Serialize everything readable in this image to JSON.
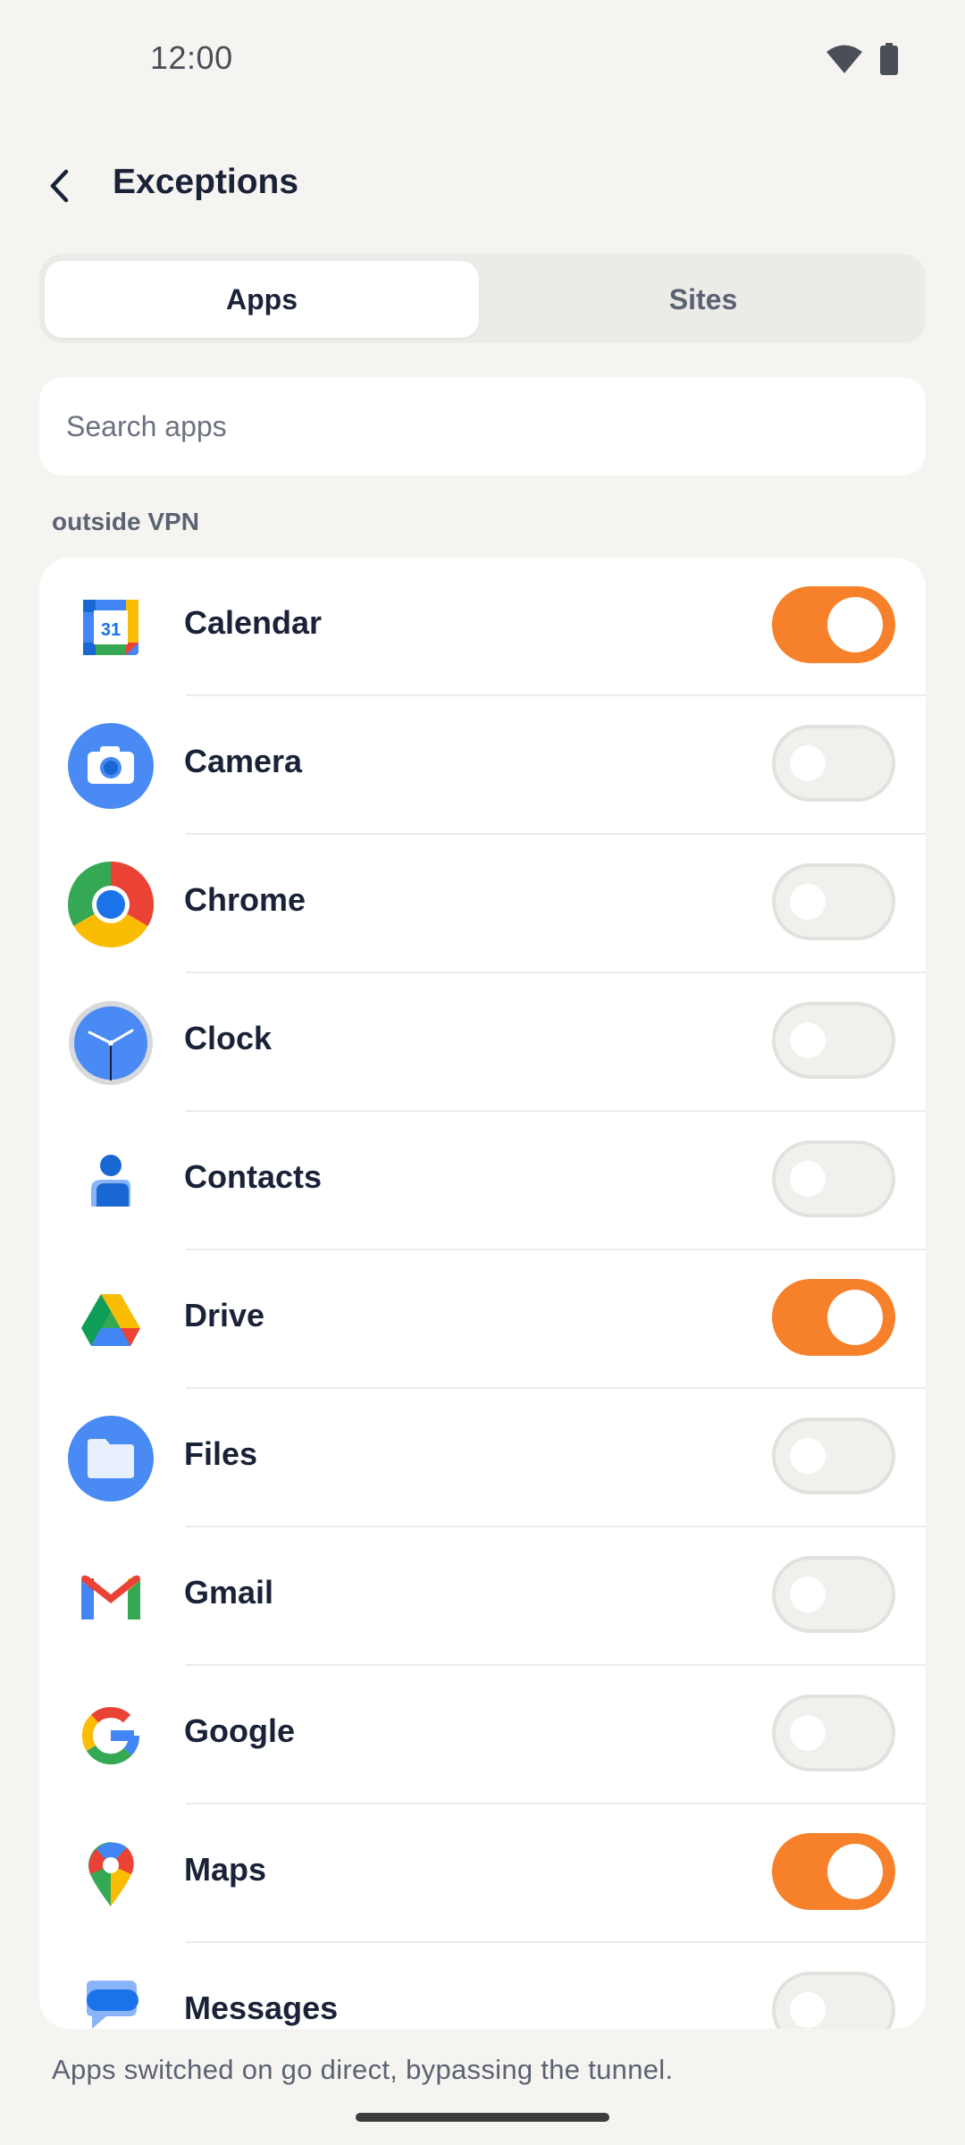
{
  "status_bar": {
    "time": "12:00",
    "icons": [
      "wifi-icon",
      "battery-icon"
    ]
  },
  "header": {
    "back_icon": "back-arrow-icon",
    "title": "Exceptions"
  },
  "tabs": [
    {
      "label": "Apps",
      "active": true
    },
    {
      "label": "Sites",
      "active": false
    }
  ],
  "search": {
    "placeholder": "Search apps",
    "value": ""
  },
  "section": {
    "label": "outside VPN"
  },
  "apps": [
    {
      "name": "Calendar",
      "icon": "calendar-icon",
      "enabled": true
    },
    {
      "name": "Camera",
      "icon": "camera-icon",
      "enabled": false
    },
    {
      "name": "Chrome",
      "icon": "chrome-icon",
      "enabled": false
    },
    {
      "name": "Clock",
      "icon": "clock-icon",
      "enabled": false
    },
    {
      "name": "Contacts",
      "icon": "contacts-icon",
      "enabled": false
    },
    {
      "name": "Drive",
      "icon": "drive-icon",
      "enabled": true
    },
    {
      "name": "Files",
      "icon": "files-icon",
      "enabled": false
    },
    {
      "name": "Gmail",
      "icon": "gmail-icon",
      "enabled": false
    },
    {
      "name": "Google",
      "icon": "google-icon",
      "enabled": false
    },
    {
      "name": "Maps",
      "icon": "maps-icon",
      "enabled": true
    },
    {
      "name": "Messages",
      "icon": "messages-icon",
      "enabled": false
    }
  ],
  "footer": {
    "note": "Apps switched on go direct, bypassing the tunnel."
  },
  "colors": {
    "accent": "#f7802a",
    "background": "#f5f4f1",
    "card": "#ffffff",
    "text_primary": "#1a2238",
    "text_secondary": "#5b6272"
  }
}
